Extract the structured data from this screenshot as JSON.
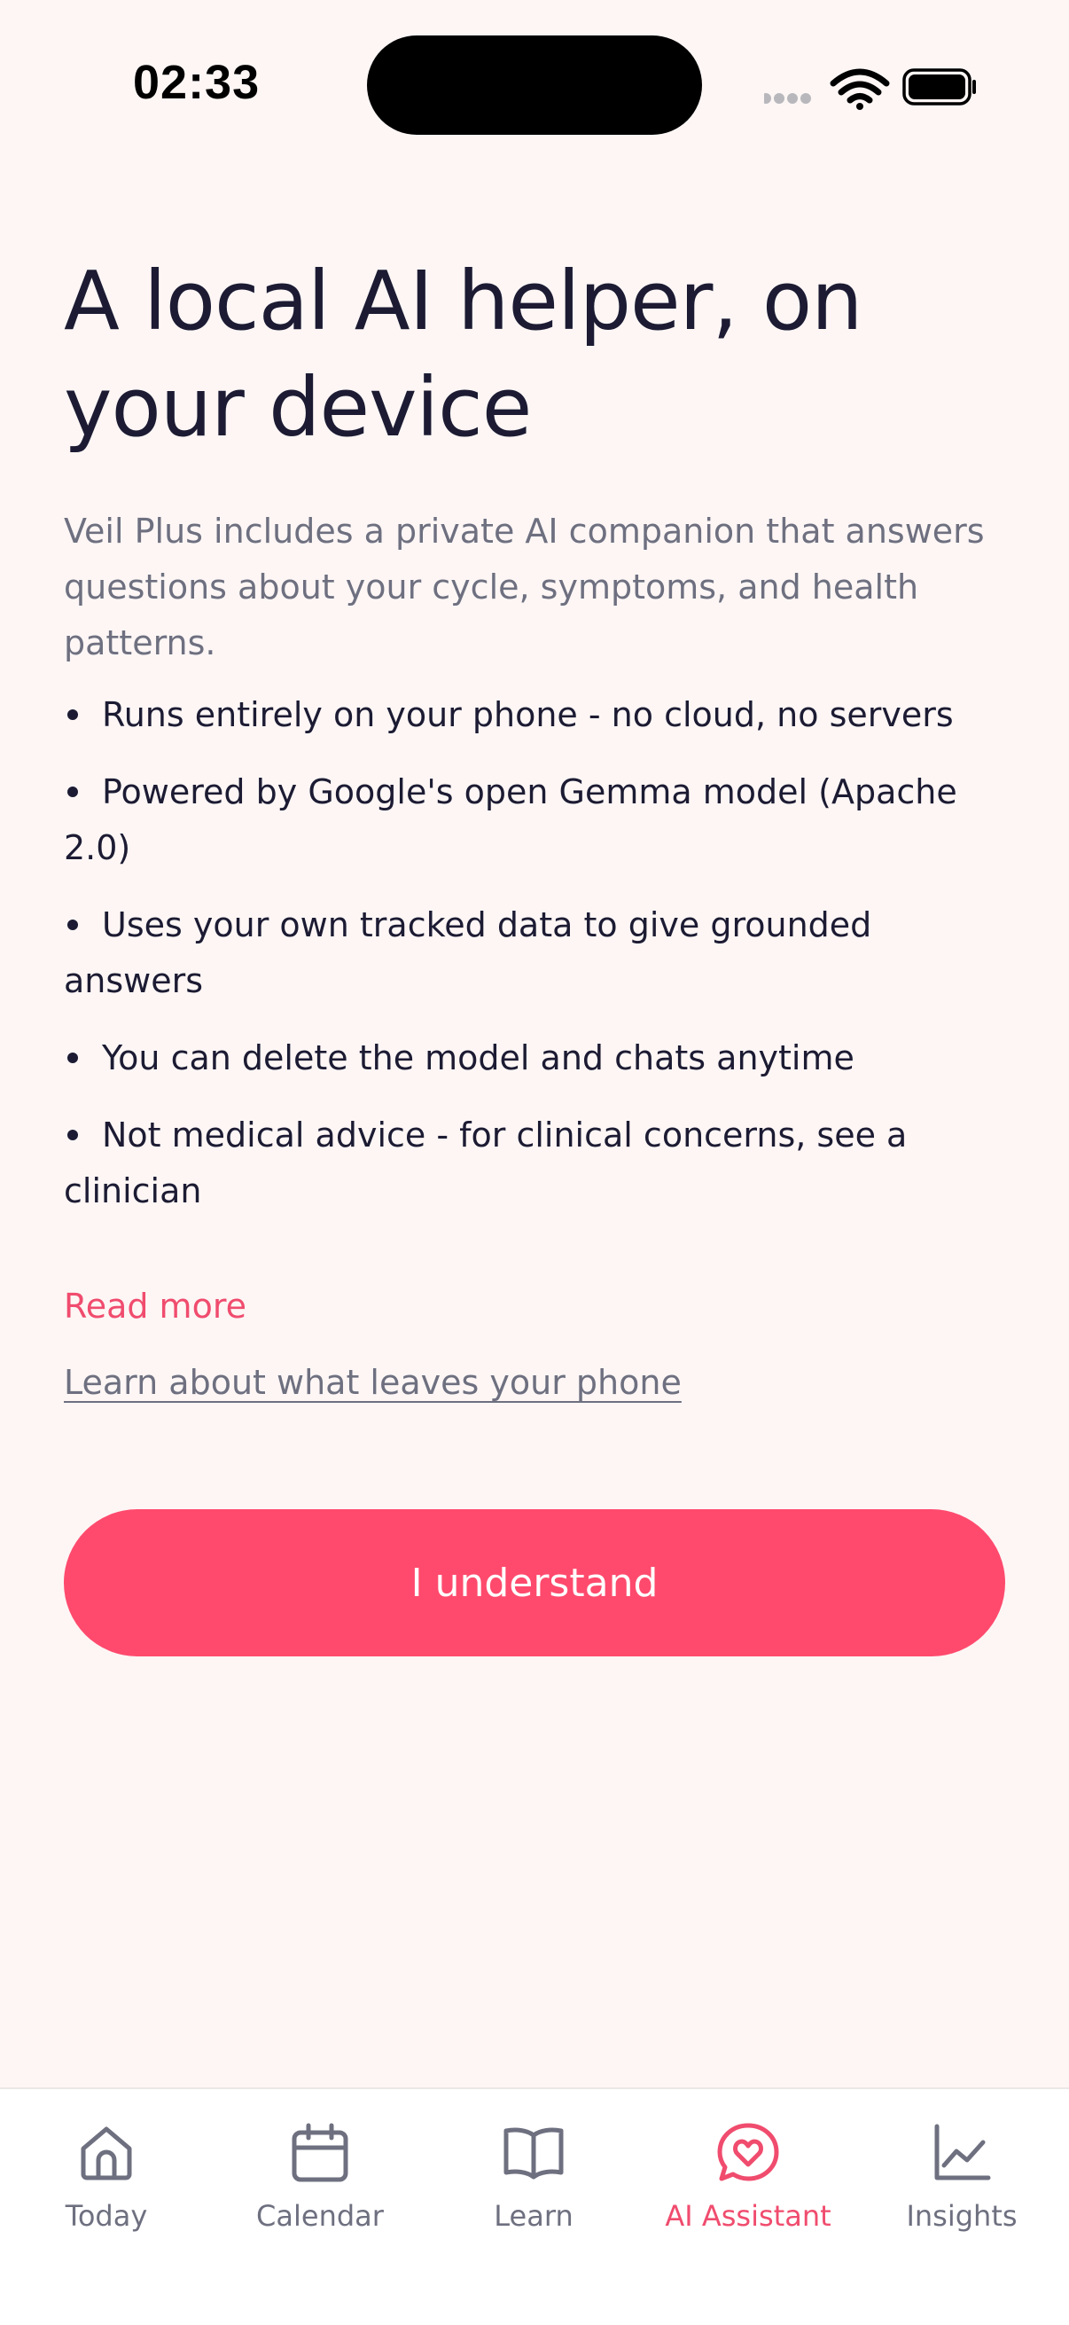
{
  "status_bar": {
    "time": "02:33",
    "icons": [
      "signal-dots-icon",
      "wifi-icon",
      "battery-icon"
    ]
  },
  "onboarding": {
    "title_line1": "A local AI helper, on",
    "title_line2": "your device",
    "intro": "Veil Plus includes a private AI companion that answers questions about your cycle, symptoms, and health patterns.",
    "bullets": [
      "Runs entirely on your phone - no cloud, no servers",
      "Powered by Google's open Gemma model (Apache 2.0)",
      "Uses your own tracked data to give grounded answers",
      "You can delete the model and chats anytime",
      "Not medical advice - for clinical concerns, see a clinician"
    ],
    "read_more": "Read more",
    "learn_link": "Learn about what leaves your phone",
    "primary_button": "I understand"
  },
  "tab_bar": {
    "active": "ai_assistant",
    "tabs": [
      {
        "id": "today",
        "label": "Today",
        "icon": "home-icon"
      },
      {
        "id": "calendar",
        "label": "Calendar",
        "icon": "calendar-icon"
      },
      {
        "id": "learn",
        "label": "Learn",
        "icon": "book-icon"
      },
      {
        "id": "ai_assistant",
        "label": "AI Assistant",
        "icon": "chat-heart-icon"
      },
      {
        "id": "insights",
        "label": "Insights",
        "icon": "chart-icon"
      }
    ]
  },
  "colors": {
    "background": "#FDF6F5",
    "accent": "#FF4A6D",
    "link_accent": "#F04C6E",
    "text_primary": "#1C1B33",
    "text_secondary": "#6E7080"
  }
}
